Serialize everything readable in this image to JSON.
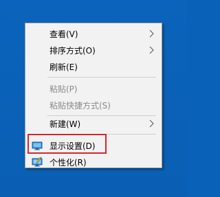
{
  "colors": {
    "desktop_background": "#0a62b8",
    "menu_background": "#f2f2f2",
    "disabled_text": "#8a8a8a",
    "annotation_box": "#d7262c"
  },
  "context_menu": {
    "items": [
      {
        "label": "查看(V)",
        "submenu": true,
        "enabled": true
      },
      {
        "label": "排序方式(O)",
        "submenu": true,
        "enabled": true
      },
      {
        "label": "刷新(E)",
        "submenu": false,
        "enabled": true
      },
      {
        "label": "粘贴(P)",
        "submenu": false,
        "enabled": false
      },
      {
        "label": "粘贴快捷方式(S)",
        "submenu": false,
        "enabled": false
      },
      {
        "label": "新建(W)",
        "submenu": true,
        "enabled": true
      },
      {
        "label": "显示设置(D)",
        "submenu": false,
        "enabled": true,
        "icon": "display-settings-icon"
      },
      {
        "label": "个性化(R)",
        "submenu": false,
        "enabled": true,
        "icon": "personalize-icon"
      }
    ]
  }
}
